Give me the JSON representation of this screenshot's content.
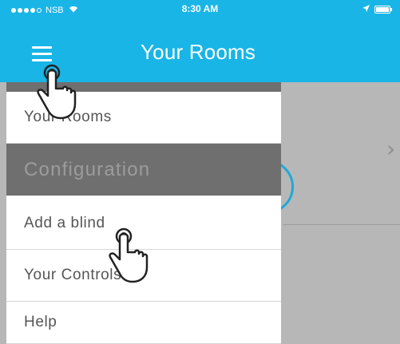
{
  "status_bar": {
    "carrier": "NSB",
    "time": "8:30 AM"
  },
  "header": {
    "title": "Your Rooms"
  },
  "menu": {
    "items": [
      {
        "label": "Your Rooms"
      },
      {
        "label": "Configuration"
      },
      {
        "label": "Add a blind"
      },
      {
        "label": "Your Controls"
      },
      {
        "label": "Help"
      }
    ]
  },
  "colors": {
    "header_bg": "#19b5e6",
    "section_bg": "#6f6f6f",
    "overlay_gray": "#b7b7b7"
  },
  "icons": [
    "menu-icon",
    "wifi-icon",
    "location-icon",
    "battery-icon",
    "chevron-right-icon",
    "hand-pointer-icon"
  ]
}
